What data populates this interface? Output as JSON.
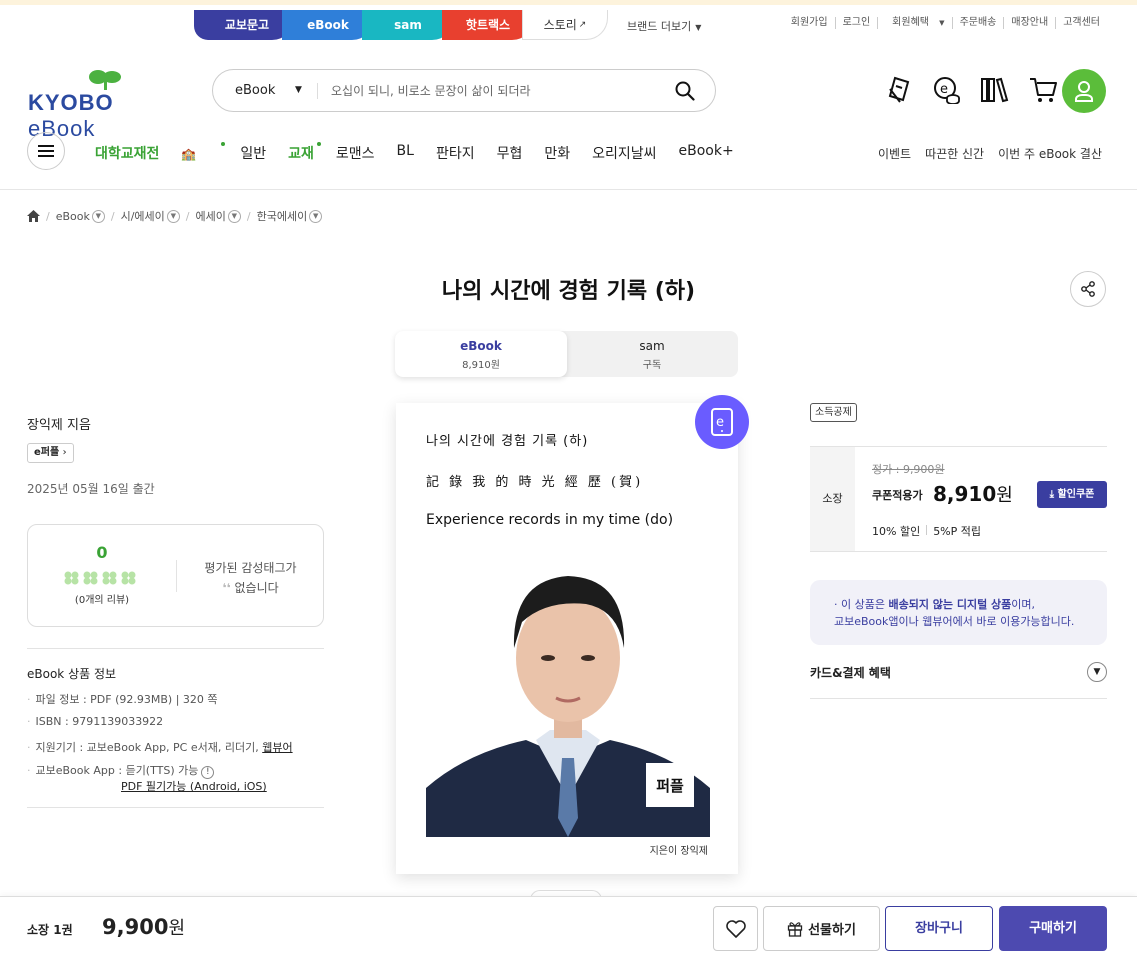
{
  "brand_tabs": [
    "교보문고",
    "eBook",
    "sam",
    "핫트랙스",
    "스토리"
  ],
  "brand_more": "브랜드 더보기",
  "top_links": [
    "회원가입",
    "로그인",
    "회원혜택",
    "주문배송",
    "매장안내",
    "고객센터"
  ],
  "logo": {
    "kyobo": "KYOBO",
    "ebook": "eBook"
  },
  "search": {
    "category": "eBook",
    "placeholder": "오십이 되니, 비로소 문장이 삶이 되더라"
  },
  "header_icons": [
    "ticket-icon",
    "ecoin-icon",
    "library-icon",
    "cart-icon",
    "user-icon"
  ],
  "gnb": {
    "items": [
      "대학교재전",
      "일반",
      "교재",
      "로맨스",
      "BL",
      "판타지",
      "무협",
      "만화",
      "오리지날씨",
      "eBook+"
    ],
    "right": [
      "이벤트",
      "따끈한 신간",
      "이번 주 eBook 결산"
    ]
  },
  "breadcrumb": [
    "eBook",
    "시/에세이",
    "에세이",
    "한국에세이"
  ],
  "product": {
    "title": "나의 시간에 경험 기록 (하)",
    "formats": [
      {
        "name": "eBook",
        "price": "8,910원"
      },
      {
        "name": "sam",
        "price": "구독"
      }
    ],
    "author": "장익제 지음",
    "badge": "e퍼플",
    "pub_date": "2025년 05월 16일 출간"
  },
  "review": {
    "score": "0",
    "count_prefix": "(",
    "count": "0",
    "count_suffix": "개의 리뷰)",
    "empty_line1": "평가된 감성태그가",
    "empty_line2": "없습니다"
  },
  "ebook_info": {
    "title": "eBook 상품 정보",
    "file": "파일 정보 : PDF (92.93MB)  | 320 쪽",
    "isbn": "ISBN : 9791139033922",
    "devices": "지원기기 : 교보eBook App, PC e서재, 리더기, ",
    "devices_link": "웹뷰어",
    "app": "교보eBook App : 듣기(TTS) 가능",
    "pdf_link": "PDF 필기가능 (Android, iOS)"
  },
  "cover": {
    "line1": "나의 시간에 경험 기록 (하)",
    "line2": "記 錄 我 的 時 光 經 歷 (賀)",
    "line3": "Experience records in my time (do)",
    "author": "지은이 장익제",
    "pyeopl": "퍼플"
  },
  "price": {
    "tax_badge": "소득공제",
    "label": "소장",
    "original": "정가 : 9,900원",
    "coupon_label": "쿠폰적용가",
    "coupon_price": "8,910",
    "won": "원",
    "coupon_btn": "할인쿠폰",
    "discount": "10% 할인",
    "points": "5%P 적립"
  },
  "notice": {
    "pre": "이 상품은 ",
    "bold": "배송되지 않는 디지털 상품",
    "post": "이며,",
    "line2": "교보eBook앱이나 웹뷰어에서 바로 이용가능합니다."
  },
  "card_benefit": "카드&결제 혜택",
  "bottom": {
    "qty": "소장 1권",
    "total": "9,900",
    "won": "원",
    "gift": "선물하기",
    "cart": "장바구니",
    "buy": "구매하기"
  },
  "colors": {
    "accent": "#3a3ea0",
    "green": "#3aa335",
    "ebadge": "#6a5cff"
  }
}
